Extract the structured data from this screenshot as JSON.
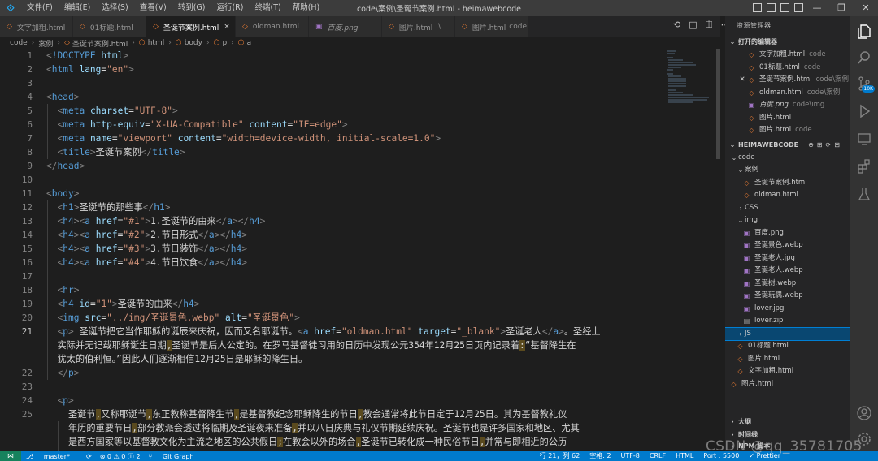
{
  "titlebar": {
    "app_icon": "vscode-logo-icon",
    "menus": [
      "文件(F)",
      "编辑(E)",
      "选择(S)",
      "查看(V)",
      "转到(G)",
      "运行(R)",
      "终端(T)",
      "帮助(H)"
    ],
    "title": "code\\案例\\圣诞节案例.html - heimawebcode",
    "window_buttons": [
      "—",
      "❐",
      "✕"
    ]
  },
  "tabs": [
    {
      "label": "文字加粗.html",
      "icon": "html-icon",
      "desc": ""
    },
    {
      "label": "01标题.html",
      "icon": "html-icon",
      "desc": ""
    },
    {
      "label": "圣诞节案例.html",
      "icon": "html-icon",
      "desc": "",
      "active": true,
      "close": "×"
    },
    {
      "label": "oldman.html",
      "icon": "html-icon",
      "desc": ""
    },
    {
      "label": "百度.png",
      "icon": "image-icon",
      "desc": "",
      "italic": true
    },
    {
      "label": "图片.html",
      "icon": "html-icon",
      "desc": ".\\"
    },
    {
      "label": "图片.html",
      "icon": "html-icon",
      "desc": "code"
    }
  ],
  "breadcrumb": [
    "code",
    "案例",
    "圣诞节案例.html",
    "html",
    "body",
    "p",
    "a"
  ],
  "editor": {
    "line_numbers": [
      "1",
      "2",
      "3",
      "4",
      "5",
      "6",
      "7",
      "8",
      "9",
      "10",
      "11",
      "12",
      "13",
      "14",
      "15",
      "16",
      "17",
      "18",
      "19",
      "20",
      "21",
      "",
      "",
      "22",
      "23",
      "24",
      "25",
      "",
      ""
    ],
    "current_line": "21"
  },
  "sidebar": {
    "header": "资源管理器",
    "open_editors_title": "打开的编辑器",
    "open_editors": [
      {
        "name": "文字加粗.html",
        "desc": "code",
        "icon": "html-icon"
      },
      {
        "name": "01标题.html",
        "desc": "code",
        "icon": "html-icon"
      },
      {
        "name": "圣诞节案例.html",
        "desc": "code\\案例",
        "icon": "html-icon",
        "close": "✕"
      },
      {
        "name": "oldman.html",
        "desc": "code\\案例",
        "icon": "html-icon"
      },
      {
        "name": "百度.png",
        "desc": "code\\img",
        "icon": "image-icon",
        "italic": true
      },
      {
        "name": "图片.html",
        "desc": "",
        "icon": "html-icon"
      },
      {
        "name": "图片.html",
        "desc": "code",
        "icon": "html-icon"
      }
    ],
    "workspace_title": "HEIMAWEBCODE",
    "tree": [
      {
        "name": "code",
        "level": 0,
        "caret": "⌄"
      },
      {
        "name": "案例",
        "level": 1,
        "caret": "⌄"
      },
      {
        "name": "圣诞节案例.html",
        "level": 2,
        "icon": "html-icon"
      },
      {
        "name": "oldman.html",
        "level": 2,
        "icon": "html-icon"
      },
      {
        "name": "CSS",
        "level": 1,
        "caret": "›"
      },
      {
        "name": "img",
        "level": 1,
        "caret": "⌄"
      },
      {
        "name": "百度.png",
        "level": 2,
        "icon": "image-icon"
      },
      {
        "name": "圣诞景色.webp",
        "level": 2,
        "icon": "image-icon"
      },
      {
        "name": "圣诞老人.jpg",
        "level": 2,
        "icon": "image-icon"
      },
      {
        "name": "圣诞老人.webp",
        "level": 2,
        "icon": "image-icon"
      },
      {
        "name": "圣诞树.webp",
        "level": 2,
        "icon": "image-icon"
      },
      {
        "name": "圣诞玩偶.webp",
        "level": 2,
        "icon": "image-icon"
      },
      {
        "name": "lover.jpg",
        "level": 2,
        "icon": "image-icon"
      },
      {
        "name": "lover.zip",
        "level": 2,
        "icon": "zip-icon"
      },
      {
        "name": "JS",
        "level": 1,
        "caret": "›",
        "selected": true
      },
      {
        "name": "01标题.html",
        "level": 1,
        "icon": "html-icon"
      },
      {
        "name": "图片.html",
        "level": 1,
        "icon": "html-icon"
      },
      {
        "name": "文字加粗.html",
        "level": 1,
        "icon": "html-icon"
      },
      {
        "name": "图片.html",
        "level": 0,
        "icon": "html-icon"
      }
    ],
    "bottom_sections": [
      "大纲",
      "时间线",
      "NPM 脚本"
    ]
  },
  "statusbar": {
    "remote": "⋈",
    "branch": "master*",
    "sync": "⟳",
    "problems": "⊗ 0 ⚠ 0 ⓘ 2",
    "git_graph": "Git Graph",
    "position": "行 21，列 62",
    "spaces": "空格: 2",
    "encoding": "UTF-8",
    "eol": "CRLF",
    "language": "HTML",
    "port": "Port : 5500",
    "prettier": "✓ Prettier"
  },
  "watermark": "CSDN @qq_35781705",
  "colors": {
    "accent": "#007acc",
    "tag": "#569cd6",
    "attr": "#9cdcfe",
    "string": "#ce9178",
    "selection": "#094771"
  }
}
